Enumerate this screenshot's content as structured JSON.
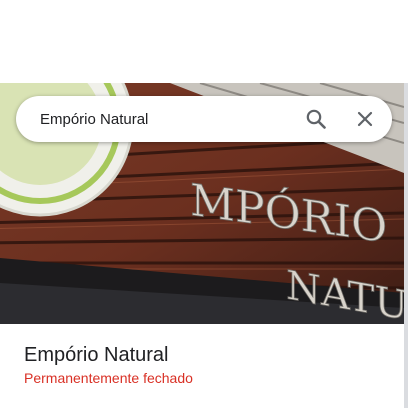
{
  "search": {
    "value": "Empório Natural",
    "search_icon": "search-icon",
    "close_icon": "close-icon"
  },
  "photo": {
    "sign_text": [
      "EMPÓRIO",
      "NATURAL"
    ]
  },
  "place": {
    "name": "Empório Natural",
    "status": "Permanentemente fechado",
    "status_color": "#d93025"
  }
}
